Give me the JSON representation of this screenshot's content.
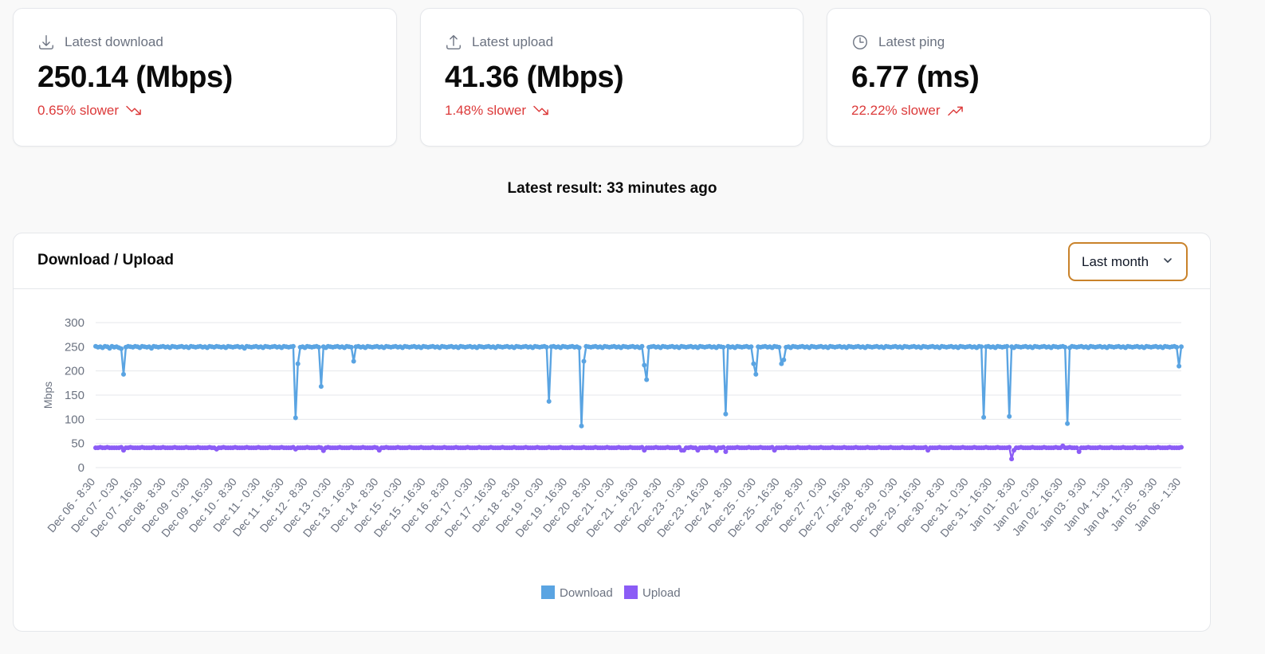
{
  "stats": [
    {
      "icon": "download-icon",
      "label": "Latest download",
      "value": "250.14 (Mbps)",
      "diff": "0.65% slower",
      "trend_icon": "trending-down-icon"
    },
    {
      "icon": "upload-icon",
      "label": "Latest upload",
      "value": "41.36 (Mbps)",
      "diff": "1.48% slower",
      "trend_icon": "trending-down-icon"
    },
    {
      "icon": "clock-icon",
      "label": "Latest ping",
      "value": "6.77 (ms)",
      "diff": "22.22% slower",
      "trend_icon": "trending-up-icon"
    }
  ],
  "latest_result": "Latest result: 33 minutes ago",
  "chart_card": {
    "title": "Download / Upload",
    "range_select": "Last month",
    "range_icon": "chevron-down-icon"
  },
  "colors": {
    "download": "#5aa4e2",
    "upload": "#8b5cf6",
    "negative": "#dc3a3a",
    "select_border": "#c9822a"
  },
  "chart_data": {
    "type": "line",
    "ylabel": "Mbps",
    "ylim": [
      0,
      300
    ],
    "yticks": [
      0,
      50,
      100,
      150,
      200,
      250,
      300
    ],
    "grid": true,
    "legend_position": "bottom",
    "x_tick_labels": [
      "Dec 06 - 8:30",
      "Dec 07 - 0:30",
      "Dec 07 - 16:30",
      "Dec 08 - 8:30",
      "Dec 09 - 0:30",
      "Dec 09 - 16:30",
      "Dec 10 - 8:30",
      "Dec 11 - 0:30",
      "Dec 11 - 16:30",
      "Dec 12 - 8:30",
      "Dec 13 - 0:30",
      "Dec 13 - 16:30",
      "Dec 14 - 8:30",
      "Dec 15 - 0:30",
      "Dec 15 - 16:30",
      "Dec 16 - 8:30",
      "Dec 17 - 0:30",
      "Dec 17 - 16:30",
      "Dec 18 - 8:30",
      "Dec 19 - 0:30",
      "Dec 19 - 16:30",
      "Dec 20 - 8:30",
      "Dec 21 - 0:30",
      "Dec 21 - 16:30",
      "Dec 22 - 8:30",
      "Dec 23 - 0:30",
      "Dec 23 - 16:30",
      "Dec 24 - 8:30",
      "Dec 25 - 0:30",
      "Dec 25 - 16:30",
      "Dec 26 - 8:30",
      "Dec 27 - 0:30",
      "Dec 27 - 16:30",
      "Dec 28 - 8:30",
      "Dec 29 - 0:30",
      "Dec 29 - 16:30",
      "Dec 30 - 8:30",
      "Dec 31 - 0:30",
      "Dec 31 - 16:30",
      "Jan 01 - 8:30",
      "Jan 02 - 0:30",
      "Jan 02 - 16:30",
      "Jan 03 - 9:30",
      "Jan 04 - 1:30",
      "Jan 04 - 17:30",
      "Jan 05 - 9:30",
      "Jan 06 - 1:30"
    ],
    "series": [
      {
        "name": "Download",
        "values": [
          251,
          249,
          250,
          248,
          251,
          250,
          247,
          251,
          249,
          250,
          248,
          246,
          193,
          249,
          251,
          250,
          249,
          251,
          250,
          248,
          251,
          250,
          249,
          250,
          247,
          251,
          250,
          249,
          250,
          251,
          249,
          250,
          248,
          251,
          250,
          249,
          250,
          251,
          249,
          250,
          248,
          251,
          250,
          249,
          250,
          251,
          249,
          250,
          248,
          251,
          250,
          249,
          251,
          250,
          249,
          250,
          248,
          251,
          250,
          249,
          250,
          251,
          249,
          250,
          247,
          251,
          250,
          249,
          250,
          251,
          249,
          250,
          248,
          251,
          250,
          249,
          250,
          251,
          249,
          250,
          248,
          251,
          250,
          249,
          250,
          251,
          103,
          215,
          249,
          250,
          248,
          251,
          250,
          249,
          250,
          251,
          249,
          168,
          250,
          248,
          251,
          250,
          249,
          250,
          251,
          249,
          250,
          248,
          251,
          250,
          249,
          220,
          250,
          251,
          249,
          250,
          248,
          251,
          250,
          249,
          250,
          251,
          249,
          250,
          248,
          251,
          250,
          249,
          250,
          251,
          249,
          250,
          248,
          251,
          250,
          249,
          250,
          251,
          249,
          250,
          248,
          251,
          250,
          249,
          250,
          251,
          249,
          250,
          248,
          251,
          250,
          249,
          250,
          251,
          249,
          250,
          248,
          251,
          250,
          249,
          250,
          251,
          249,
          250,
          248,
          251,
          250,
          249,
          250,
          251,
          249,
          250,
          248,
          251,
          250,
          249,
          250,
          251,
          249,
          250,
          248,
          251,
          250,
          249,
          250,
          251,
          249,
          250,
          248,
          251,
          250,
          249,
          250,
          251,
          249,
          137,
          250,
          251,
          249,
          250,
          248,
          251,
          250,
          249,
          250,
          251,
          249,
          250,
          248,
          86,
          220,
          251,
          250,
          249,
          250,
          251,
          249,
          250,
          248,
          251,
          250,
          249,
          250,
          251,
          249,
          250,
          248,
          251,
          250,
          249,
          250,
          251,
          249,
          250,
          248,
          251,
          212,
          182,
          249,
          250,
          251,
          249,
          250,
          248,
          251,
          250,
          249,
          250,
          251,
          249,
          250,
          248,
          251,
          250,
          249,
          250,
          251,
          249,
          250,
          248,
          251,
          250,
          249,
          250,
          251,
          249,
          250,
          248,
          251,
          250,
          249,
          111,
          251,
          249,
          250,
          248,
          251,
          250,
          249,
          250,
          251,
          249,
          250,
          215,
          193,
          250,
          249,
          250,
          251,
          249,
          250,
          248,
          251,
          250,
          249,
          215,
          223,
          249,
          250,
          248,
          251,
          250,
          249,
          250,
          251,
          249,
          250,
          248,
          251,
          250,
          249,
          250,
          251,
          249,
          250,
          248,
          251,
          250,
          249,
          250,
          251,
          249,
          250,
          248,
          251,
          250,
          249,
          250,
          251,
          249,
          250,
          248,
          251,
          250,
          249,
          250,
          251,
          249,
          250,
          248,
          251,
          250,
          249,
          250,
          251,
          249,
          250,
          248,
          251,
          250,
          249,
          250,
          251,
          249,
          250,
          248,
          251,
          250,
          249,
          250,
          251,
          249,
          250,
          248,
          251,
          250,
          249,
          250,
          251,
          249,
          250,
          248,
          251,
          250,
          249,
          250,
          251,
          249,
          250,
          248,
          251,
          250,
          104,
          250,
          251,
          249,
          250,
          248,
          251,
          250,
          249,
          250,
          251,
          106,
          250,
          248,
          251,
          250,
          249,
          250,
          251,
          249,
          250,
          248,
          251,
          250,
          249,
          250,
          251,
          249,
          250,
          248,
          251,
          250,
          249,
          250,
          251,
          249,
          91,
          248,
          251,
          250,
          249,
          250,
          251,
          249,
          250,
          248,
          251,
          250,
          249,
          250,
          251,
          249,
          250,
          248,
          251,
          250,
          249,
          250,
          251,
          249,
          250,
          248,
          251,
          250,
          249,
          250,
          251,
          249,
          250,
          248,
          251,
          250,
          249,
          250,
          251,
          249,
          250,
          248,
          251,
          250,
          249,
          250,
          251,
          249,
          210,
          250
        ]
      },
      {
        "name": "Upload",
        "values": [
          41,
          41,
          42,
          41,
          41,
          42,
          41,
          41,
          41,
          41,
          41,
          42,
          36,
          41,
          41,
          42,
          41,
          41,
          41,
          41,
          42,
          41,
          41,
          41,
          41,
          42,
          41,
          41,
          41,
          42,
          41,
          41,
          41,
          41,
          42,
          41,
          41,
          41,
          41,
          42,
          41,
          41,
          41,
          41,
          42,
          41,
          41,
          41,
          41,
          42,
          41,
          41,
          38,
          41,
          41,
          42,
          41,
          41,
          41,
          41,
          42,
          41,
          41,
          41,
          41,
          42,
          41,
          41,
          41,
          41,
          42,
          41,
          41,
          41,
          41,
          42,
          41,
          41,
          41,
          41,
          42,
          41,
          41,
          41,
          41,
          42,
          38,
          41,
          41,
          41,
          41,
          42,
          41,
          41,
          41,
          41,
          42,
          41,
          35,
          41,
          42,
          41,
          41,
          41,
          41,
          42,
          41,
          41,
          41,
          41,
          42,
          41,
          41,
          41,
          41,
          42,
          41,
          41,
          41,
          41,
          42,
          41,
          36,
          41,
          41,
          42,
          41,
          41,
          41,
          41,
          42,
          41,
          41,
          41,
          41,
          42,
          41,
          41,
          41,
          41,
          42,
          41,
          41,
          41,
          41,
          42,
          41,
          41,
          41,
          41,
          42,
          41,
          41,
          41,
          41,
          42,
          41,
          41,
          41,
          41,
          42,
          41,
          41,
          41,
          41,
          42,
          41,
          41,
          41,
          41,
          42,
          41,
          41,
          41,
          41,
          42,
          41,
          41,
          41,
          41,
          42,
          41,
          41,
          41,
          41,
          42,
          41,
          41,
          41,
          41,
          42,
          41,
          41,
          41,
          41,
          42,
          41,
          41,
          41,
          41,
          42,
          41,
          41,
          41,
          41,
          42,
          41,
          41,
          41,
          41,
          42,
          41,
          41,
          41,
          41,
          42,
          41,
          41,
          41,
          41,
          42,
          41,
          41,
          41,
          41,
          42,
          41,
          41,
          41,
          41,
          42,
          41,
          41,
          41,
          41,
          42,
          36,
          41,
          41,
          41,
          41,
          42,
          41,
          41,
          41,
          41,
          42,
          41,
          41,
          41,
          41,
          42,
          36,
          36,
          41,
          41,
          42,
          41,
          41,
          36,
          41,
          41,
          41,
          41,
          42,
          41,
          41,
          35,
          41,
          41,
          42,
          33,
          41,
          41,
          41,
          41,
          42,
          41,
          41,
          41,
          41,
          42,
          41,
          41,
          41,
          41,
          42,
          41,
          41,
          41,
          41,
          42,
          36,
          41,
          41,
          41,
          41,
          42,
          41,
          41,
          41,
          41,
          42,
          41,
          41,
          41,
          41,
          42,
          41,
          41,
          41,
          41,
          42,
          41,
          41,
          41,
          41,
          42,
          41,
          41,
          41,
          41,
          42,
          41,
          41,
          41,
          41,
          42,
          41,
          41,
          41,
          41,
          42,
          41,
          41,
          41,
          41,
          42,
          41,
          41,
          41,
          41,
          42,
          41,
          41,
          41,
          41,
          42,
          41,
          41,
          41,
          41,
          42,
          41,
          41,
          41,
          41,
          42,
          36,
          41,
          41,
          41,
          41,
          42,
          41,
          41,
          41,
          41,
          42,
          41,
          41,
          41,
          41,
          42,
          41,
          41,
          41,
          41,
          42,
          41,
          41,
          41,
          41,
          42,
          41,
          41,
          41,
          41,
          42,
          41,
          41,
          41,
          41,
          42,
          18,
          36,
          41,
          41,
          42,
          41,
          41,
          41,
          41,
          42,
          41,
          41,
          41,
          41,
          42,
          41,
          41,
          41,
          41,
          42,
          41,
          41,
          45,
          41,
          41,
          42,
          41,
          41,
          41,
          33,
          41,
          41,
          41,
          42,
          41,
          41,
          41,
          41,
          42,
          41,
          41,
          41,
          41,
          42,
          41,
          41,
          41,
          41,
          42,
          41,
          41,
          41,
          41,
          42,
          41,
          41,
          41,
          41,
          42,
          41,
          41,
          41,
          41,
          42,
          41,
          41,
          41,
          41,
          42,
          41,
          41,
          41,
          41,
          42
        ]
      }
    ]
  }
}
